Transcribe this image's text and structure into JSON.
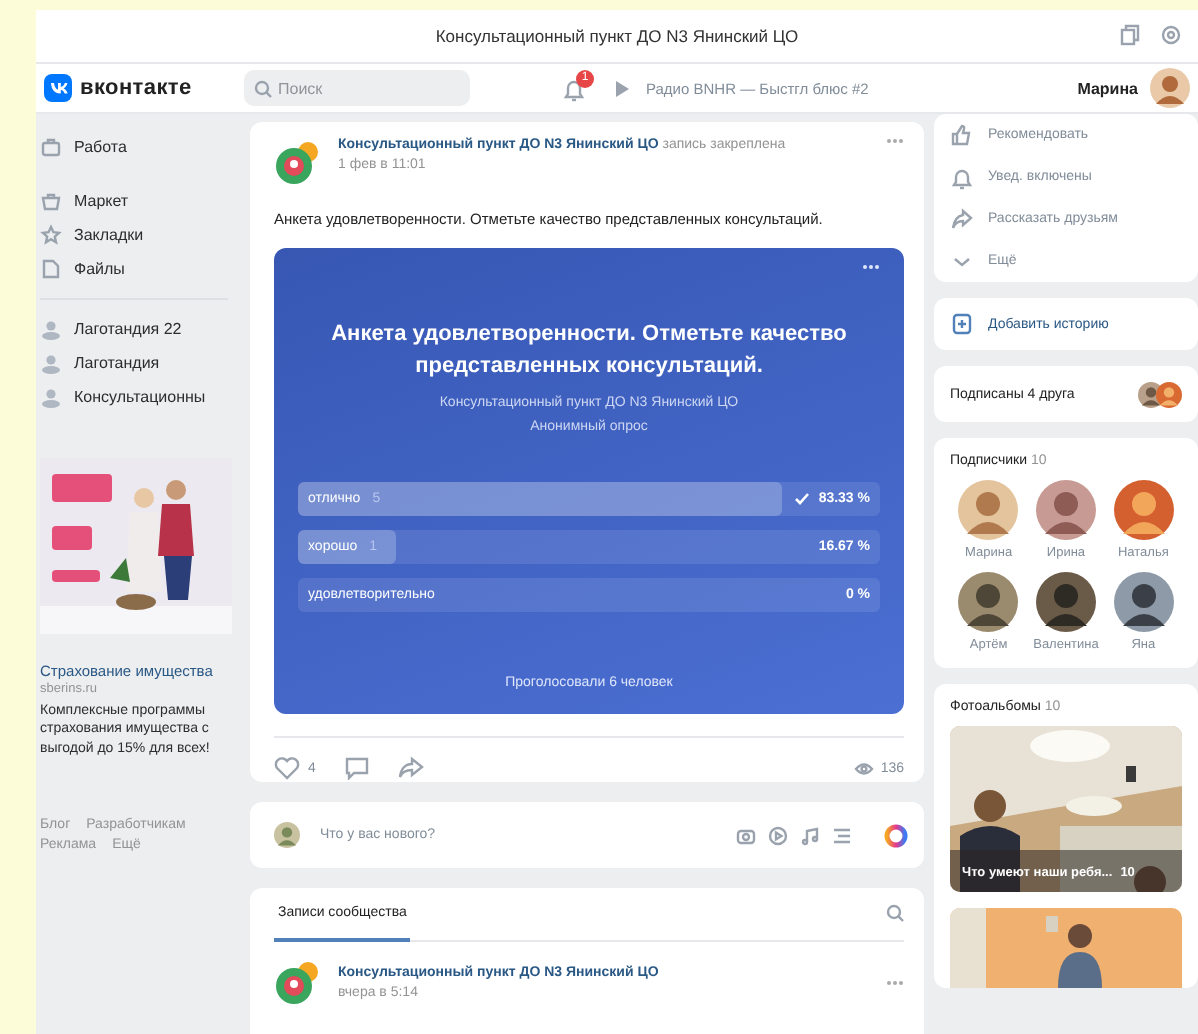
{
  "window": {
    "title": "Консультационный пункт ДО N3 Янинский ЦО"
  },
  "header": {
    "logo": "вконтакте",
    "search": {
      "placeholder": "Поиск"
    },
    "notifications": "1",
    "player": "Радио BNHR — Быстгл блюс #2",
    "user": "Марина"
  },
  "sidebar": {
    "sections": [
      {
        "kind": "menu",
        "items": [
          "Работа"
        ]
      },
      {
        "kind": "menu",
        "items": [
          "Маркет",
          "Закладки",
          "Файлы"
        ]
      },
      {
        "kind": "communities",
        "items": [
          "Лаготандия 22",
          "Лаготандия",
          "Консультационны"
        ]
      }
    ],
    "ad": {
      "kind": "picture",
      "title": "Страхование имущества",
      "domain": "sberins.ru",
      "text": "Комплексные программы страхования имущества с выгодой до 15% для всех!"
    },
    "footer": [
      "Блог",
      "Разработчикам",
      "Реклама",
      "Ещё"
    ]
  },
  "post": {
    "author": "Консультационный пункт ДО N3 Янинский ЦО",
    "pinned": "запись закреплена",
    "date": "1 фев в 11:01",
    "text": "Анкета удовлетворенности. Отметьте качество представленных консультаций.",
    "poll": {
      "title": "Анкета удовлетворенности. Отметьте качество представленных консультаций.",
      "author": "Консультационный пункт ДО N3 Янинский ЦО",
      "type": "Анонимный опрос",
      "options": [
        {
          "label": "отлично",
          "count": "5",
          "percent": "83.33 %",
          "level": 0.8333,
          "selected": true
        },
        {
          "label": "хорошо",
          "count": "1",
          "percent": "16.67 %",
          "level": 0.1667,
          "selected": false
        },
        {
          "label": "удовлетворительно",
          "percent": "0 %",
          "level": 0,
          "selected": false
        }
      ],
      "total": "Проголосовали 6 человек"
    },
    "likes": "4",
    "views": "136"
  },
  "composer": {
    "placeholder": "Что у вас нового?"
  },
  "wall": {
    "tab": "Записи сообщества",
    "post": {
      "author": "Консультационный пункт ДО N3 Янинский ЦО",
      "date": "вчера в 5:14"
    }
  },
  "right": {
    "actions": [
      "Рекомендовать",
      "Увед. включены",
      "Рассказать друзьям",
      "Ещё"
    ],
    "story": "Добавить историю",
    "friends": "Подписаны 4 друга",
    "subscribers": {
      "title": "Подписчики",
      "count": "10",
      "people": [
        "Марина",
        "Ирина",
        "Наталья",
        "Артём",
        "Валентина",
        "Яна"
      ]
    },
    "albums": {
      "title": "Фотоальбомы",
      "count": "10",
      "caption": "Что умеют наши ребя...",
      "caption_count": "10"
    }
  }
}
